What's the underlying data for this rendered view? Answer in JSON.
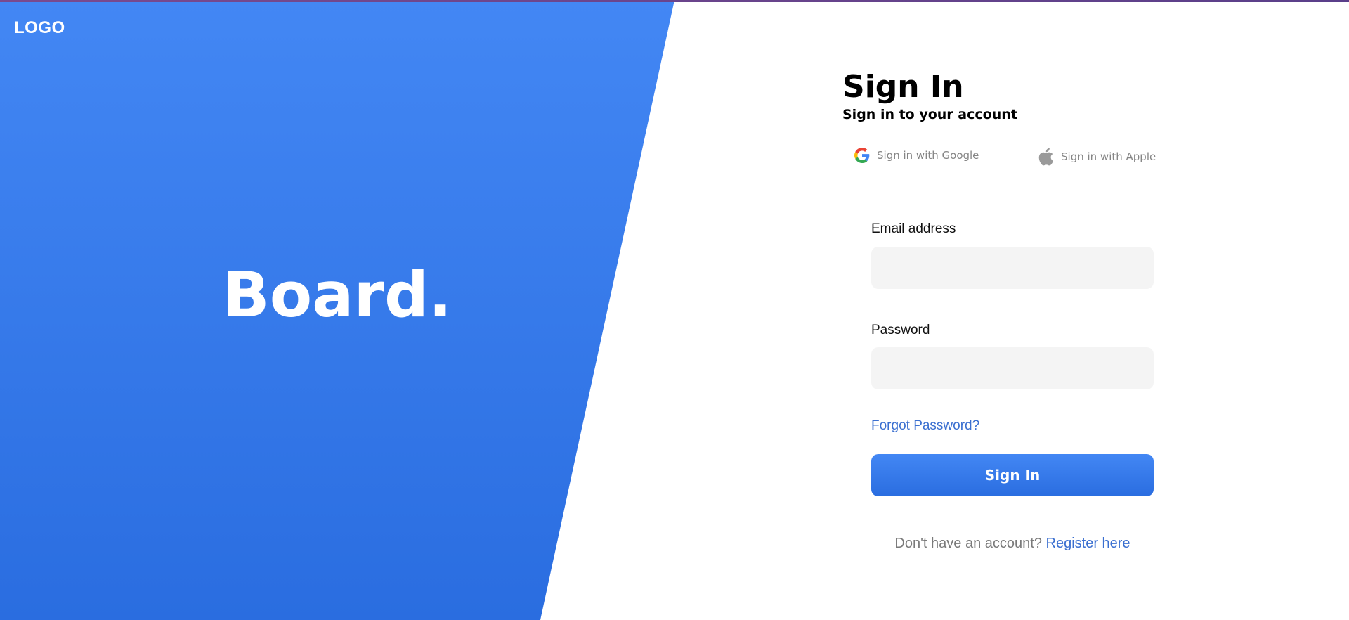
{
  "brand": {
    "logo": "LOGO",
    "name": "Board."
  },
  "form": {
    "title": "Sign In",
    "subtitle": "Sign in to your account",
    "social": {
      "google_label": "Sign in with Google",
      "apple_label": "Sign in with Apple",
      "google_icon": "google-icon",
      "apple_icon": "apple-icon"
    },
    "email": {
      "label": "Email address",
      "value": "",
      "placeholder": ""
    },
    "password": {
      "label": "Password",
      "value": "",
      "placeholder": ""
    },
    "forgot_label": "Forgot Password?",
    "submit_label": "Sign In",
    "register_prompt": "Don't have an account?",
    "register_link": "Register here"
  },
  "colors": {
    "accent": "#4387f4",
    "accent_dark": "#2a6de0",
    "link": "#3a6fd0",
    "input_bg": "#f4f4f4",
    "muted_text": "#858585"
  }
}
